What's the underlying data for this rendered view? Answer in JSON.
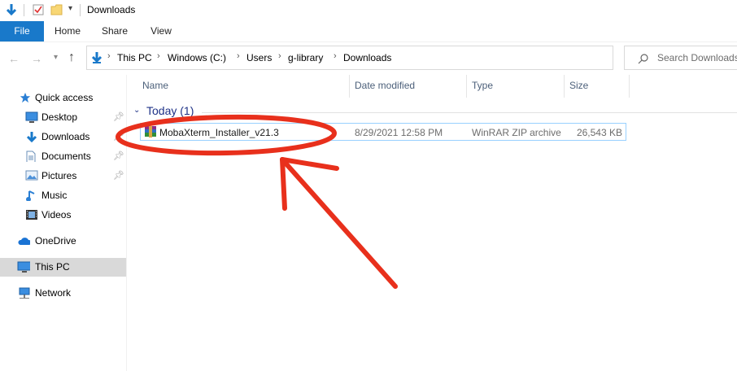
{
  "window": {
    "title": "Downloads"
  },
  "ribbon": {
    "tabs": [
      "File",
      "Home",
      "Share",
      "View"
    ]
  },
  "address": {
    "crumbs": [
      "This PC",
      "Windows (C:)",
      "Users",
      "g-library",
      "Downloads"
    ]
  },
  "search": {
    "placeholder": "Search Downloads"
  },
  "nav": {
    "quick_access": "Quick access",
    "items": [
      "Desktop",
      "Downloads",
      "Documents",
      "Pictures",
      "Music",
      "Videos"
    ],
    "onedrive": "OneDrive",
    "this_pc": "This PC",
    "network": "Network"
  },
  "columns": {
    "name": "Name",
    "date": "Date modified",
    "type": "Type",
    "size": "Size"
  },
  "group": {
    "label": "Today (1)"
  },
  "files": [
    {
      "name": "MobaXterm_Installer_v21.3",
      "date": "8/29/2021 12:58 PM",
      "type": "WinRAR ZIP archive",
      "size": "26,543 KB",
      "icon": "winrar-archive-icon"
    }
  ],
  "annotation": {
    "color": "#e8301c"
  }
}
